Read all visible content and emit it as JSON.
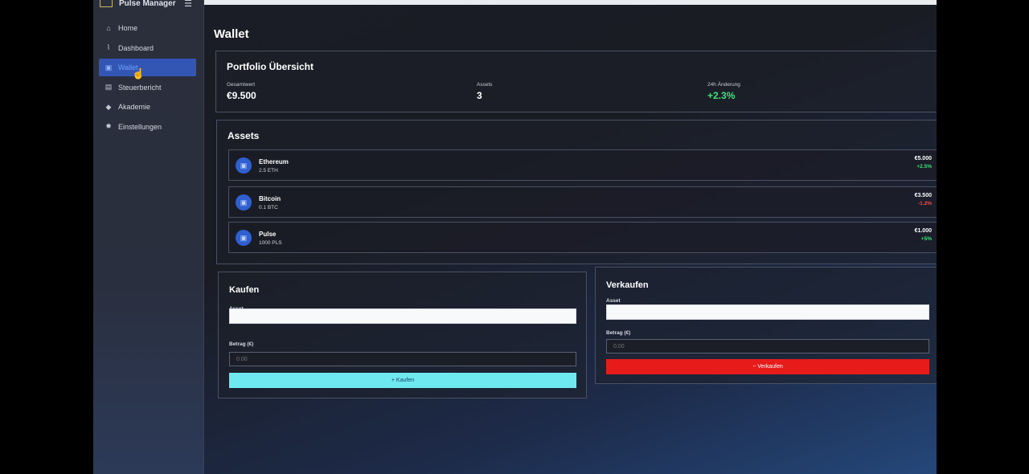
{
  "app": {
    "name": "Pulse Manager",
    "menu_icon": "hamburger-icon"
  },
  "sidebar": {
    "items": [
      {
        "label": "Home",
        "icon": "home-icon",
        "glyph": "⌂",
        "active": false
      },
      {
        "label": "Dashboard",
        "icon": "chart-icon",
        "glyph": "⌇",
        "active": false
      },
      {
        "label": "Wallet",
        "icon": "wallet-icon",
        "glyph": "▣",
        "active": true
      },
      {
        "label": "Steuerbericht",
        "icon": "document-icon",
        "glyph": "▤",
        "active": false
      },
      {
        "label": "Akademie",
        "icon": "graduation-cap-icon",
        "glyph": "◆",
        "active": false
      },
      {
        "label": "Einstellungen",
        "icon": "gear-icon",
        "glyph": "✹",
        "active": false
      }
    ]
  },
  "page": {
    "title": "Wallet"
  },
  "overview": {
    "title": "Portfolio Übersicht",
    "total": {
      "label": "Gesamtwert",
      "value": "€9.500"
    },
    "assets": {
      "label": "Assets",
      "value": "3"
    },
    "change": {
      "label": "24h Änderung",
      "value": "+2.3%"
    }
  },
  "assets": {
    "title": "Assets",
    "items": [
      {
        "name": "Ethereum",
        "qty": "2.5 ETH",
        "value": "€5.000",
        "change": "+2.5%",
        "direction": "up"
      },
      {
        "name": "Bitcoin",
        "qty": "0.1 BTC",
        "value": "€3.500",
        "change": "-1.2%",
        "direction": "down"
      },
      {
        "name": "Pulse",
        "qty": "1000 PLS",
        "value": "€1.000",
        "change": "+5%",
        "direction": "up"
      }
    ]
  },
  "buy": {
    "title": "Kaufen",
    "asset_label": "Asset",
    "asset_value": "",
    "amount_label": "Betrag (€)",
    "amount_placeholder": "0.00",
    "button": "+  Kaufen",
    "button_color": "#6ee9f0"
  },
  "sell": {
    "title": "Verkaufen",
    "asset_label": "Asset",
    "asset_value": "",
    "amount_label": "Betrag (€)",
    "amount_placeholder": "0.00",
    "button": "−  Verkaufen",
    "button_color": "#e81b1b"
  },
  "colors": {
    "accent": "#3356b5",
    "positive": "#41e27a",
    "negative": "#ff4d4d"
  }
}
